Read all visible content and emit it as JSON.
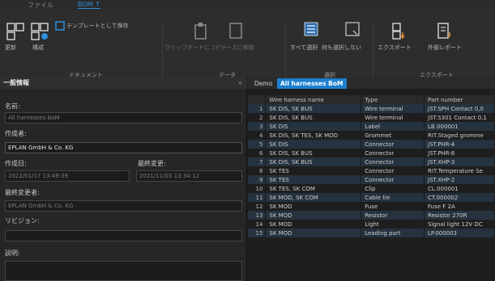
{
  "menubar": {
    "tab_file": "ファイル",
    "tab_edit": "BOM ↑"
  },
  "ribbon": {
    "update": "更新",
    "compose": "構成",
    "save_template": "テンプレートとして保存",
    "copy_clipboard": "クリップボードにコピー",
    "move_source": "ソースに移動",
    "select_all": "すべて選択",
    "deselect": "何も選択しない",
    "export": "エクスポート",
    "external_report": "外部レポート",
    "group_document": "ドキュメント",
    "group_data": "データ",
    "group_select": "選択",
    "group_export": "エクスポート"
  },
  "left": {
    "header": "一般情報",
    "pin": "«",
    "name_label": "名前:",
    "name_value": "All harnesses BoM",
    "author_label": "作成者:",
    "author_value": "EPLAN GmbH & Co. KG",
    "created_label": "作成日:",
    "created_value": "2022/01/17 13:49:39",
    "modified_label": "最終変更:",
    "modified_value": "2021/11/03 13:34:12",
    "modifier_label": "最終変更者:",
    "modifier_value": "EPLAN GmbH & Co. KG",
    "revision_label": "リビジョン:",
    "revision_value": "",
    "description_label": "説明:",
    "description_value": ""
  },
  "right": {
    "tab_demo": "Demo",
    "tab_bom": "All harnesses BoM",
    "columns": [
      "",
      "Wire harness name",
      "Type",
      "Part number"
    ],
    "rows": [
      [
        "1",
        "SK DIS, SK BUS",
        "Wire terminal",
        "JST.SPH Contact 0,0"
      ],
      [
        "2",
        "SK DIS, SK BUS",
        "Wire terminal",
        "JST.S301 Contact 0,1"
      ],
      [
        "3",
        "SK DIS",
        "Label",
        "LB.000001"
      ],
      [
        "4",
        "SK DIS, SK TES, SK MOD",
        "Grommet",
        "RIT.Staged gromme"
      ],
      [
        "5",
        "SK DIS",
        "Connector",
        "JST.PHR-4"
      ],
      [
        "6",
        "SK DIS, SK BUS",
        "Connector",
        "JST.PHR-8"
      ],
      [
        "7",
        "SK DIS, SK BUS",
        "Connector",
        "JST.XHP-3"
      ],
      [
        "8",
        "SK TES",
        "Connector",
        "RIT.Temperature Se"
      ],
      [
        "9",
        "SK TES",
        "Connector",
        "JST.XHP-2"
      ],
      [
        "10",
        "SK TES, SK COM",
        "Clip",
        "CL.000001"
      ],
      [
        "11",
        "SK MOD, SK COM",
        "Cable tie",
        "CT.000002"
      ],
      [
        "12",
        "SK MOD",
        "Fuse",
        "Fuse F 2A"
      ],
      [
        "13",
        "SK MOD",
        "Resistor",
        "Resistor 270R"
      ],
      [
        "14",
        "SK MOD",
        "Light",
        "Signal light 12V DC"
      ],
      [
        "15",
        "SK MOD",
        "Leading part",
        "LP.000003"
      ]
    ]
  }
}
